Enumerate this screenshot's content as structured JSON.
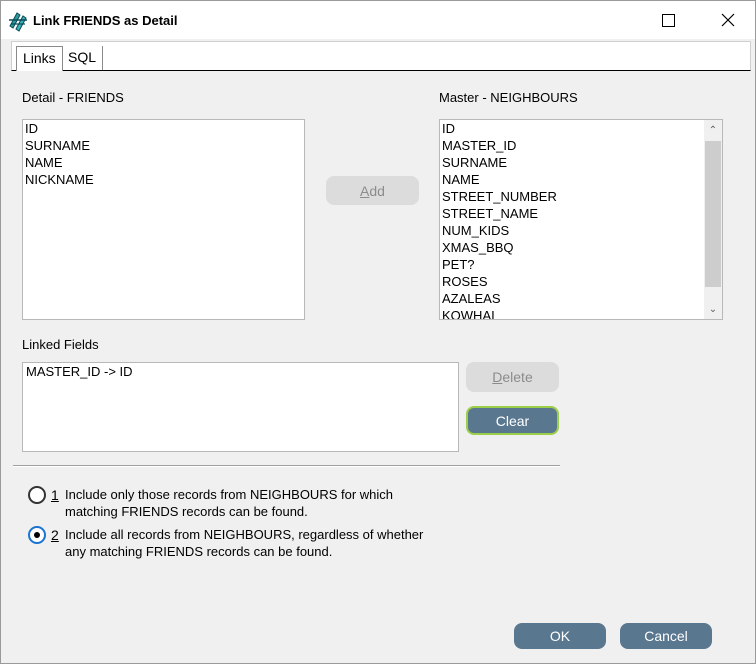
{
  "window": {
    "title": "Link FRIENDS as Detail"
  },
  "tabs": [
    {
      "label": "Links"
    },
    {
      "label": "SQL"
    }
  ],
  "detail": {
    "label": "Detail - FRIENDS",
    "fields": [
      "ID",
      "SURNAME",
      "NAME",
      "NICKNAME"
    ]
  },
  "master": {
    "label": "Master - NEIGHBOURS",
    "fields": [
      "ID",
      "MASTER_ID",
      "SURNAME",
      "NAME",
      "STREET_NUMBER",
      "STREET_NAME",
      "NUM_KIDS",
      "XMAS_BBQ",
      "PET?",
      "ROSES",
      "AZALEAS",
      "KOWHAI"
    ]
  },
  "buttons": {
    "add_mnemonic": "A",
    "add_rest": "dd",
    "delete_mnemonic": "D",
    "delete_rest": "elete",
    "clear": "Clear",
    "ok": "OK",
    "cancel": "Cancel"
  },
  "linked": {
    "label": "Linked Fields",
    "items": [
      "MASTER_ID -> ID"
    ]
  },
  "options": [
    {
      "num": "1",
      "line1": "Include only those records from NEIGHBOURS for which",
      "line2": "matching FRIENDS records can be found.",
      "selected": false
    },
    {
      "num": "2",
      "line1": "Include all records from NEIGHBOURS, regardless of whether",
      "line2": "any matching FRIENDS records can be found.",
      "selected": true
    }
  ],
  "icons": {
    "app": "link-tables-icon",
    "maximize": "maximize-icon",
    "close": "close-icon"
  },
  "colors": {
    "primary_button": "#5a7790",
    "focus_ring": "#9bcf4a",
    "radio_selected": "#1a74d1"
  }
}
